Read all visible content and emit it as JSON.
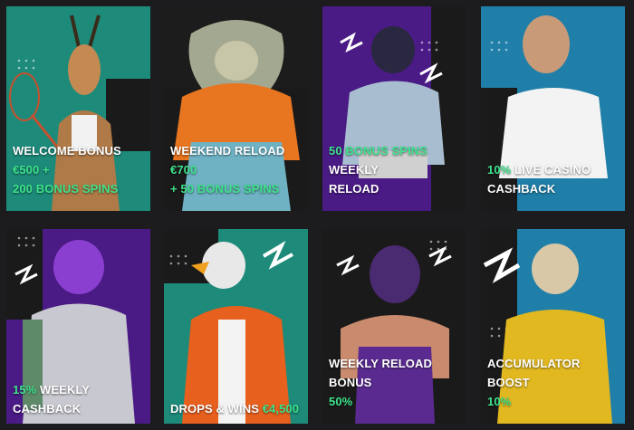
{
  "colors": {
    "accent_green": "#3ee38c",
    "text": "#ffffff",
    "teal": "#1d8a7a",
    "purple": "#4a1a85",
    "blue": "#1f7fa8",
    "page_bg": "#1c1c1e"
  },
  "cards": [
    {
      "white1": "WELCOME BONUS ",
      "green1": "€500 +",
      "green2": "200 BONUS SPINS",
      "white2": "",
      "icon": "gazelle-mascot"
    },
    {
      "white1": "WEEKEND RELOAD ",
      "green1": "€700",
      "green2": "+ 50 BONUS SPINS",
      "white2": "",
      "icon": "lizard-mascot"
    },
    {
      "green1": "50 BONUS SPINS",
      "white1": " WEEKLY",
      "white2": "RELOAD",
      "icon": "panther-mascot"
    },
    {
      "green1": "10%",
      "white1": " LIVE CASINO",
      "white2": "CASHBACK",
      "icon": "dog-mascot"
    },
    {
      "green1": "15%",
      "white1": " WEEKLY CASHBACK",
      "icon": "wolf-mascot"
    },
    {
      "white1": "DROPS & WINS ",
      "green1": "€4,500",
      "icon": "eagle-mascot"
    },
    {
      "white1": "WEEKLY RELOAD BONUS",
      "green1": "50%",
      "icon": "gorilla-mascot"
    },
    {
      "white1": "ACCUMULATOR BOOST",
      "green1": "10%",
      "icon": "lynx-mascot"
    }
  ]
}
